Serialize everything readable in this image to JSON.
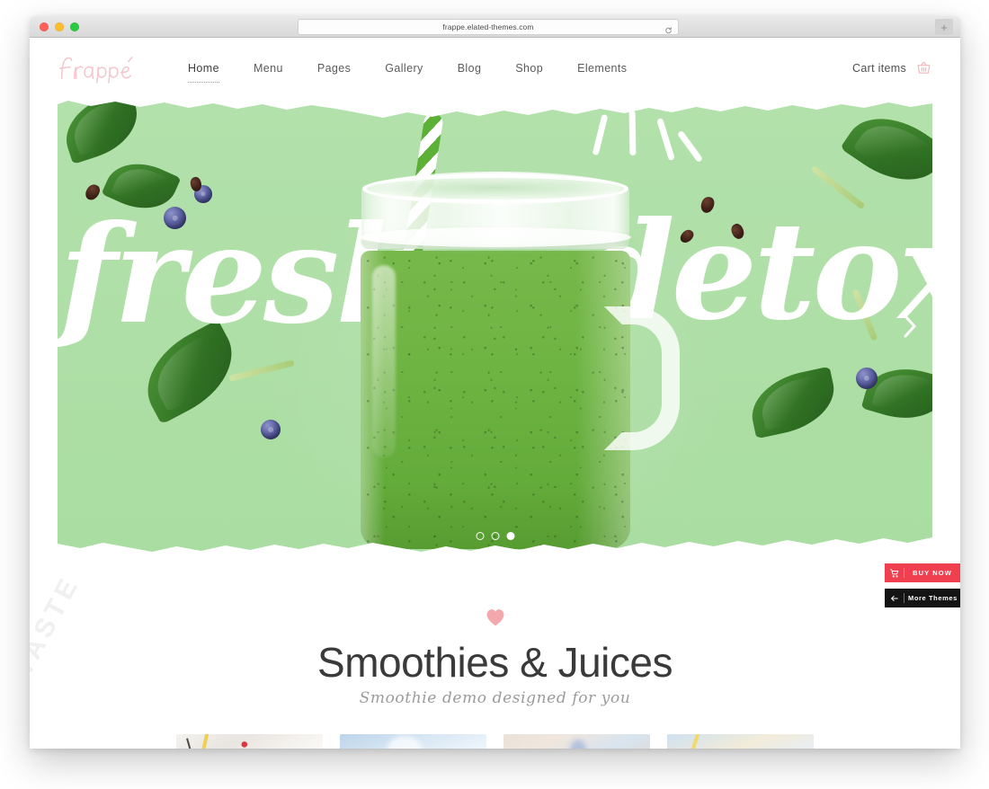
{
  "browser": {
    "url": "frappe.elated-themes.com",
    "reload_icon": "reload-icon",
    "new_tab_label": "+",
    "traffic_lights": [
      "close",
      "minimize",
      "maximize"
    ]
  },
  "header": {
    "logo_text": "Frappé",
    "nav_items": [
      {
        "label": "Home",
        "active": true
      },
      {
        "label": "Menu",
        "active": false
      },
      {
        "label": "Pages",
        "active": false
      },
      {
        "label": "Gallery",
        "active": false
      },
      {
        "label": "Blog",
        "active": false
      },
      {
        "label": "Shop",
        "active": false
      },
      {
        "label": "Elements",
        "active": false
      }
    ],
    "cart_label": "Cart items",
    "cart_icon": "shopping-basket-icon"
  },
  "hero": {
    "word_left": "fresh",
    "word_right": "detox",
    "next_icon": "chevron-right-icon",
    "dots": [
      {
        "active": false
      },
      {
        "active": false
      },
      {
        "active": true
      }
    ],
    "background_color": "#aedfa6",
    "smoothie_color": "#6fb544"
  },
  "floating": {
    "buy_now_label": "BUY NOW",
    "buy_now_icon": "cart-icon",
    "buy_now_color": "#f0404f",
    "more_themes_label": "More Themes",
    "more_themes_icon": "arrow-left-icon",
    "more_themes_color": "#141414"
  },
  "promo": {
    "heart_icon": "heart-icon",
    "heart_color": "#f3a8ad",
    "title": "Smoothies & Juices",
    "subtitle": "Smoothie demo designed for you"
  },
  "watermark": {
    "text": "TASTE"
  },
  "products": {
    "cards": [
      {
        "name": "product-card-1"
      },
      {
        "name": "product-card-2"
      },
      {
        "name": "product-card-3"
      },
      {
        "name": "product-card-4"
      }
    ]
  }
}
